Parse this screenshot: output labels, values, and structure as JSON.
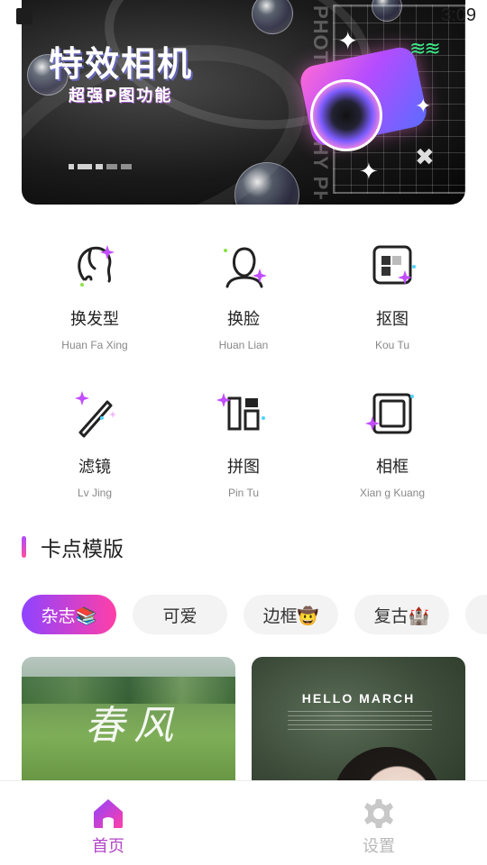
{
  "status_bar": {
    "time": "3:09"
  },
  "banner": {
    "title": "特效相机",
    "subtitle": "超强P图功能",
    "vertical_text": "PHOTOGRAPHY PHOTOGRAPHY PHOTOGRAPHY"
  },
  "features": [
    {
      "name": "换发型",
      "pinyin": "Huan Fa Xing",
      "icon": "hairstyle-icon"
    },
    {
      "name": "换脸",
      "pinyin": "Huan Lian",
      "icon": "face-swap-icon"
    },
    {
      "name": "抠图",
      "pinyin": "Kou Tu",
      "icon": "cutout-icon"
    },
    {
      "name": "滤镜",
      "pinyin": "Lv Jing",
      "icon": "filter-wand-icon"
    },
    {
      "name": "拼图",
      "pinyin": "Pin Tu",
      "icon": "collage-icon"
    },
    {
      "name": "相框",
      "pinyin": "Xian  g Kuang",
      "icon": "frame-icon"
    }
  ],
  "section": {
    "title": "卡点模版"
  },
  "chips": [
    {
      "label": "杂志📚",
      "active": true
    },
    {
      "label": "可爱",
      "active": false
    },
    {
      "label": "边框🤠",
      "active": false
    },
    {
      "label": "复古🏰",
      "active": false
    }
  ],
  "cards": [
    {
      "script_text": "春风"
    },
    {
      "headline": "HELLO MARCH"
    }
  ],
  "bottom_nav": [
    {
      "label": "首页",
      "icon": "home-icon",
      "active": true
    },
    {
      "label": "设置",
      "icon": "settings-gear-icon",
      "active": false
    }
  ],
  "colors": {
    "accent_purple": "#8f43ff",
    "accent_pink": "#ff3fa8",
    "nav_active": "#b245c8",
    "nav_inactive": "#b8b8b8"
  }
}
